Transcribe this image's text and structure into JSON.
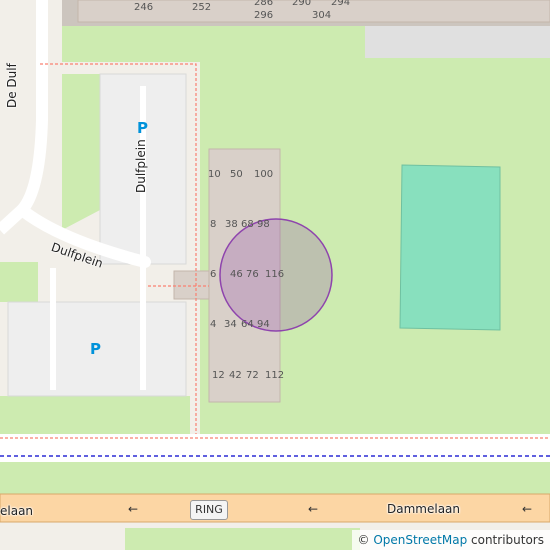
{
  "map": {
    "streets": {
      "de_dulf": "De Dulf",
      "dulfplein": "Dulfplein",
      "dammelaan_left": "elaan",
      "dammelaan": "Dammelaan",
      "ring_shield": "RING"
    },
    "parking_symbol": "P",
    "house_numbers": [
      "246",
      "252",
      "286",
      "290",
      "294",
      "296",
      "304",
      "10",
      "50",
      "100",
      "8",
      "38",
      "68",
      "98",
      "6",
      "46",
      "76",
      "116",
      "4",
      "34",
      "64",
      "94",
      "12",
      "42",
      "72",
      "112"
    ],
    "colors": {
      "land": "#f2efe9",
      "grass": "#cdebb0",
      "sports_pitch": "#88e0be",
      "building": "#d9d0c9",
      "road_primary": "#fcd6a4",
      "footway": "#fa8072",
      "path_blue": "#0000cc",
      "marker": "#8e44ad"
    },
    "icons": [
      "arrow-left-icon"
    ]
  },
  "attribution": {
    "symbol": "©",
    "link_text": "OpenStreetMap",
    "suffix": "contributors"
  }
}
